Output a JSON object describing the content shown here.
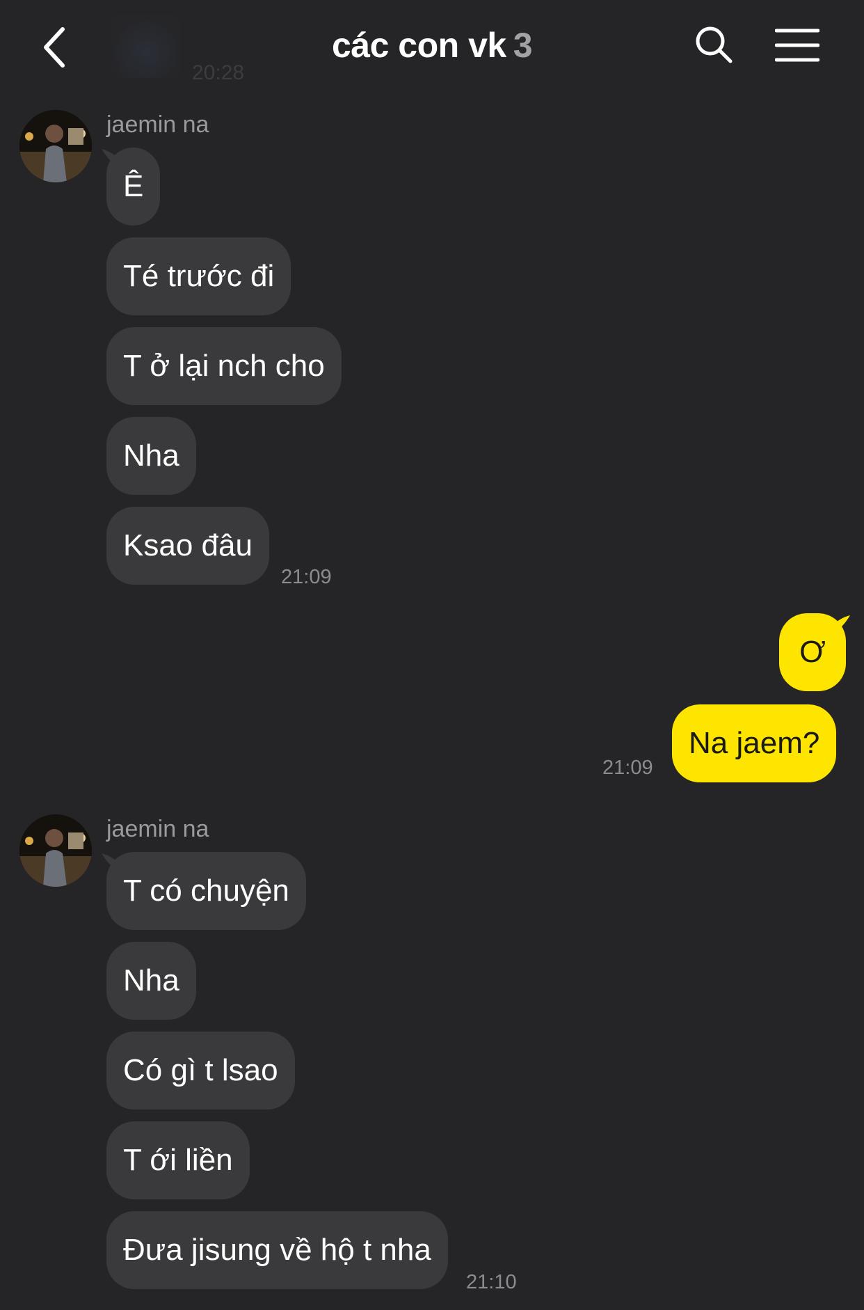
{
  "header": {
    "title": "các con vk",
    "member_count": "3",
    "faded_time": "20:28",
    "back_icon": "chevron-left-icon",
    "search_icon": "search-icon",
    "menu_icon": "menu-icon"
  },
  "colors": {
    "background": "#252527",
    "received_bubble": "#3a3a3c",
    "sent_bubble": "#fee500",
    "timestamp": "#8c8c90"
  },
  "groups": [
    {
      "sender": "jaemin na",
      "messages": [
        "Ê",
        "Té trước đi",
        "T ở lại nch cho",
        "Nha",
        "Ksao đâu"
      ],
      "time": "21:09"
    },
    {
      "sender": "me",
      "messages": [
        "Ơ",
        "Na jaem?"
      ],
      "time": "21:09"
    },
    {
      "sender": "jaemin na",
      "messages": [
        "T có chuyện",
        "Nha",
        "Có gì t lsao",
        "T ới liền",
        "Đưa jisung về hộ t nha"
      ],
      "time": "21:10"
    }
  ]
}
